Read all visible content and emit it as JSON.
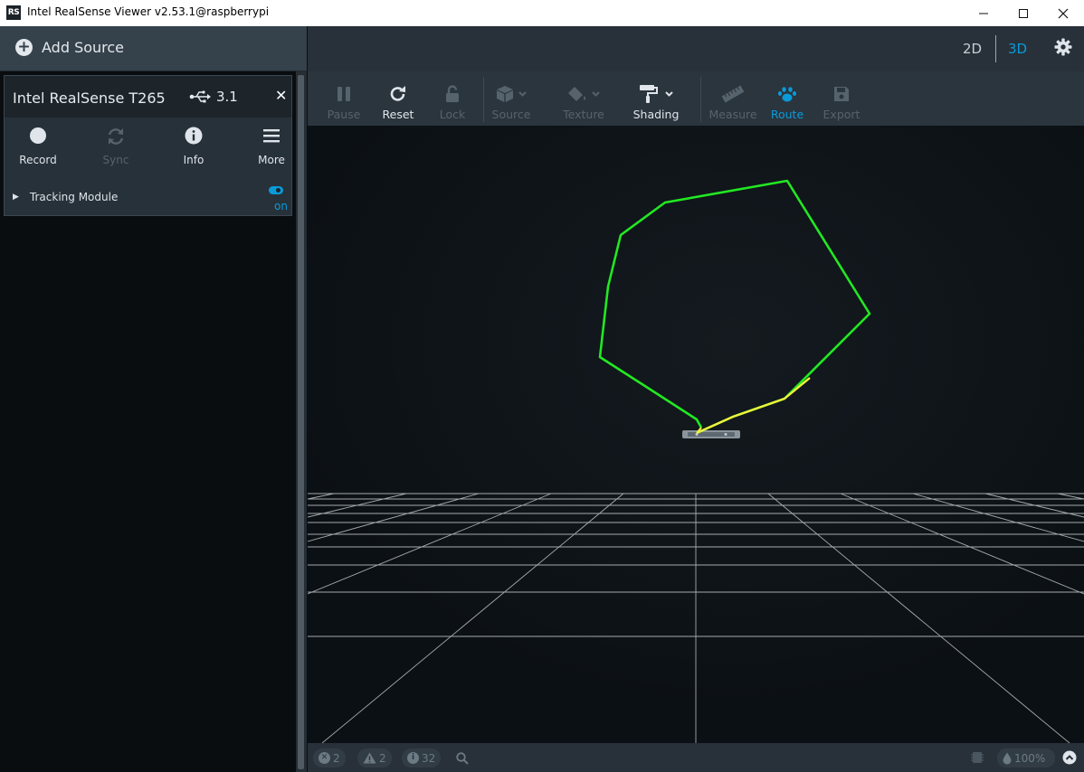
{
  "window": {
    "app_icon_text": "RS",
    "title": "Intel RealSense Viewer v2.53.1@raspberrypi"
  },
  "header": {
    "add_source": "Add Source",
    "view_2d": "2D",
    "view_3d": "3D",
    "active_view": "3D",
    "icons": {
      "settings": "gear-icon",
      "add": "plus-circle-icon"
    }
  },
  "device": {
    "name": "Intel RealSense T265",
    "usb_version": "3.1",
    "buttons": [
      {
        "label": "Record",
        "icon": "record-icon",
        "enabled": true
      },
      {
        "label": "Sync",
        "icon": "sync-icon",
        "enabled": false
      },
      {
        "label": "Info",
        "icon": "info-icon",
        "enabled": true
      },
      {
        "label": "More",
        "icon": "menu-icon",
        "enabled": true
      }
    ],
    "module": {
      "label": "Tracking Module",
      "state": "on"
    }
  },
  "toolbar": {
    "pause": "Pause",
    "reset": "Reset",
    "lock": "Lock",
    "source": "Source",
    "texture": "Texture",
    "shading": "Shading",
    "measure": "Measure",
    "route": "Route",
    "export": "Export"
  },
  "status": {
    "errors": "2",
    "warnings": "2",
    "info": "32",
    "opacity": "100%"
  },
  "colors": {
    "accent": "#0a9ad8",
    "route_line": "#22e822",
    "route_recent": "#f2f23a",
    "grid": "#d8dde0"
  }
}
